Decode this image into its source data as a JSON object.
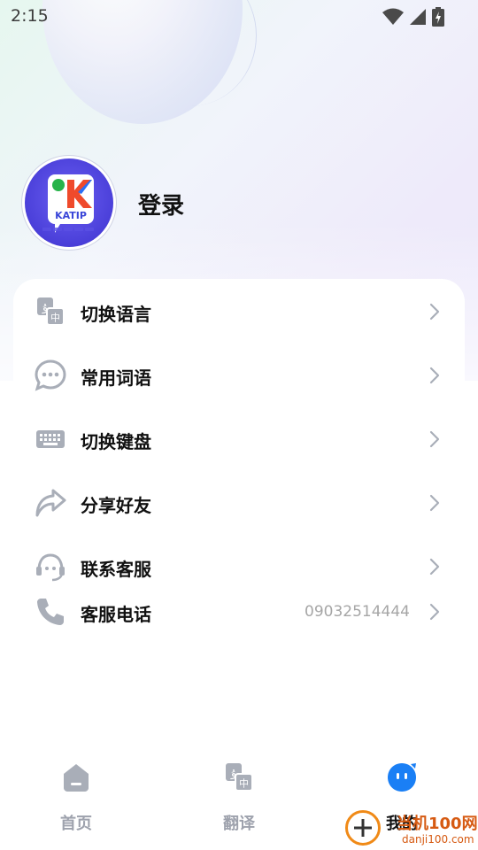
{
  "status_bar": {
    "time": "2:15",
    "icons": [
      "wifi-icon",
      "signal-icon",
      "battery-charging-icon"
    ]
  },
  "profile": {
    "avatar_logo_text": "KATIP",
    "login_label": "登录"
  },
  "menu": [
    {
      "icon": "translate-language-icon",
      "label": "切换语言"
    },
    {
      "icon": "chat-bubble-icon",
      "label": "常用词语"
    },
    {
      "icon": "keyboard-icon",
      "label": "切换键盘"
    },
    {
      "icon": "share-icon",
      "label": "分享好友"
    },
    {
      "icon": "customer-service-icon",
      "label": "联系客服"
    },
    {
      "icon": "phone-icon",
      "label": "客服电话",
      "value": "09032514444"
    }
  ],
  "bottom_nav": [
    {
      "icon": "home-icon",
      "label": "首页",
      "active": false
    },
    {
      "icon": "translate-icon",
      "label": "翻译",
      "active": false
    },
    {
      "icon": "profile-face-icon",
      "label": "我的",
      "active": true
    }
  ],
  "watermark": {
    "top": "当机100网",
    "bottom": "danji100.com"
  },
  "colors": {
    "accent": "#1a7ff5",
    "icon_gray": "#a9aeb8",
    "text_primary": "#111111",
    "text_muted": "#a6a6a6",
    "nav_inactive": "#9ea2ad",
    "avatar_purple": "#4a3fd9"
  }
}
